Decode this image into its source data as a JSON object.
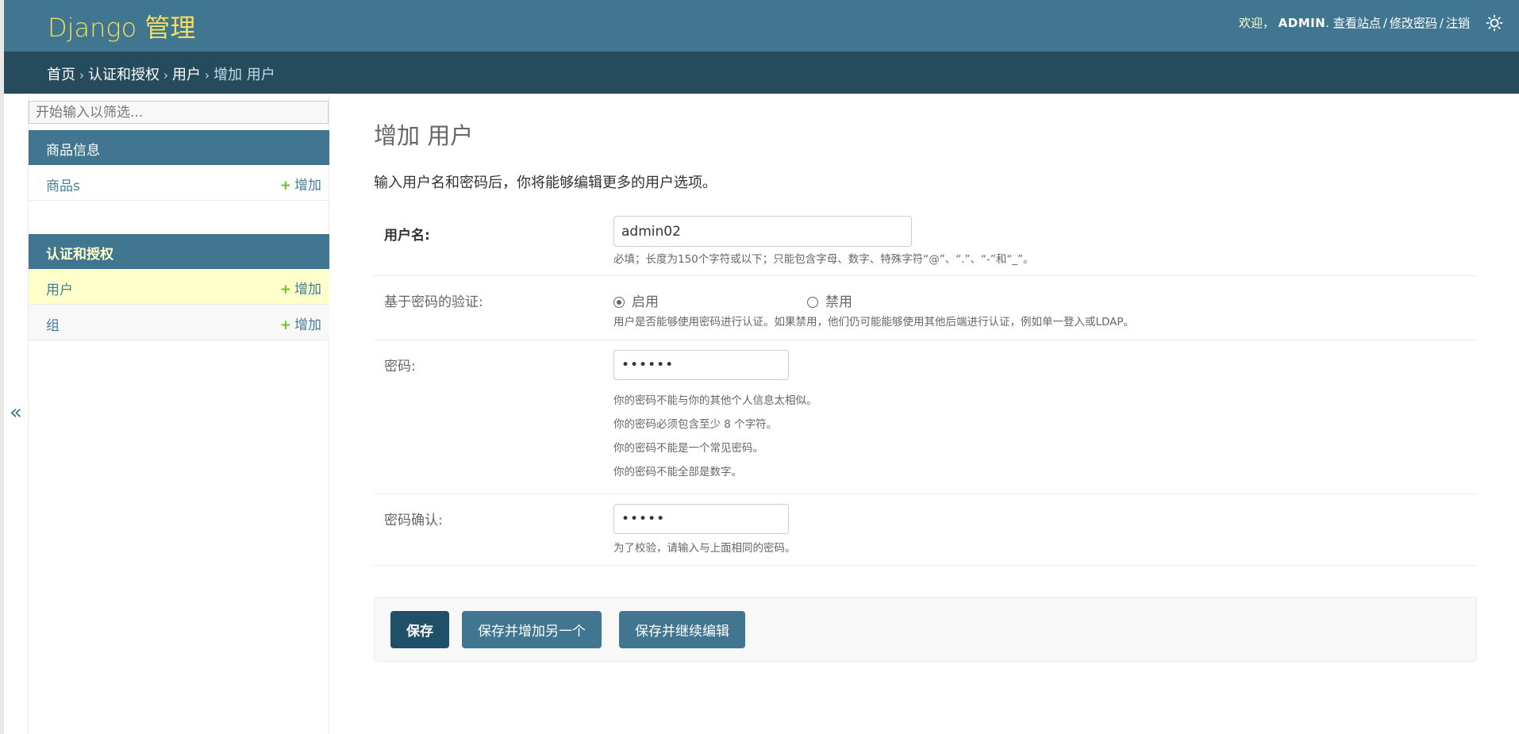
{
  "header": {
    "brand": "Django 管理",
    "welcome": "欢迎，",
    "username": "ADMIN",
    "view_site": "查看站点",
    "change_password": "修改密码",
    "logout": "注销",
    "theme_icon": "sun-icon"
  },
  "breadcrumbs": {
    "home": "首页",
    "app": "认证和授权",
    "model": "用户",
    "current": "增加 用户",
    "separator": "›"
  },
  "sidebar": {
    "filter_placeholder": "开始输入以筛选...",
    "toggle": "«",
    "modules": [
      {
        "caption": "商品信息",
        "items": [
          {
            "label": "商品s",
            "add": "增加"
          }
        ]
      },
      {
        "caption": "认证和授权",
        "items": [
          {
            "label": "用户",
            "add": "增加",
            "current": true
          },
          {
            "label": "组",
            "add": "增加"
          }
        ]
      }
    ],
    "add_icon": "+"
  },
  "main": {
    "title": "增加 用户",
    "intro": "输入用户名和密码后，你将能够编辑更多的用户选项。",
    "username": {
      "label": "用户名:",
      "value": "admin02",
      "help": "必填；长度为150个字符或以下；只能包含字母、数字、特殊字符“@”、“.”、“-”和“_”。"
    },
    "usable_password": {
      "label": "基于密码的验证:",
      "enabled": "启用",
      "disabled": "禁用",
      "selected": "启用",
      "help": "用户是否能够使用密码进行认证。如果禁用，他们仍可能能够使用其他后端进行认证，例如单一登入或LDAP。"
    },
    "password1": {
      "label": "密码:",
      "value": "••••••",
      "help": [
        "你的密码不能与你的其他个人信息太相似。",
        "你的密码必须包含至少 8 个字符。",
        "你的密码不能是一个常见密码。",
        "你的密码不能全部是数字。"
      ]
    },
    "password2": {
      "label": "密码确认:",
      "value": "•••••",
      "help": "为了校验，请输入与上面相同的密码。"
    },
    "buttons": {
      "save": "保存",
      "save_add": "保存并增加另一个",
      "save_continue": "保存并继续编辑"
    }
  },
  "colors": {
    "header": "#417690",
    "breadcrumbs": "#264b5d",
    "brand": "#f5dd5d",
    "link": "#447e9b",
    "add_plus": "#70bf2b",
    "current_row": "#ffffcc",
    "default_button": "#205067"
  }
}
